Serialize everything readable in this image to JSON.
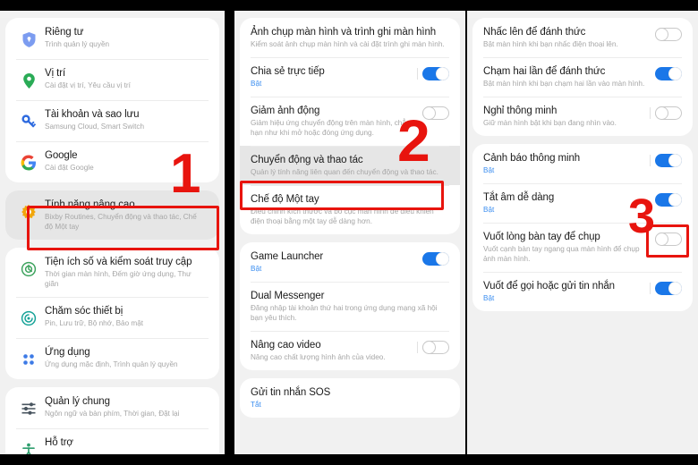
{
  "annotations": {
    "accent_red": "#e8140e",
    "markers": [
      {
        "label": "1"
      },
      {
        "label": "2"
      },
      {
        "label": "3"
      }
    ]
  },
  "colors": {
    "toggle_on": "#1a77e8",
    "state_text": "#3b8ef0",
    "title_text": "#1b1b1b",
    "sub_text": "#a6a6a6",
    "panel_bg": "#f1f1f1",
    "card_bg": "#ffffff",
    "highlight_bg": "#e6e6e6"
  },
  "panels": [
    {
      "name": "settings-main",
      "groups": [
        {
          "rows": [
            {
              "icon": "shield-icon",
              "title": "Riêng tư",
              "sub": "Trình quản lý quyền"
            },
            {
              "icon": "location-pin-icon",
              "title": "Vị trí",
              "sub": "Cài đặt vị trí, Yêu cầu vị trí"
            },
            {
              "icon": "key-icon",
              "title": "Tài khoản và sao lưu",
              "sub": "Samsung Cloud, Smart Switch"
            },
            {
              "icon": "google-g-icon",
              "title": "Google",
              "sub": "Cài đặt Google"
            }
          ]
        },
        {
          "rows": [
            {
              "icon": "gear-icon",
              "title": "Tính năng nâng cao",
              "sub": "Bixby Routines, Chuyển động và thao tác, Chế độ Một tay",
              "highlight": true
            }
          ]
        },
        {
          "rows": [
            {
              "icon": "digital-wellbeing-icon",
              "title": "Tiện ích số và kiểm soát truy cập",
              "sub": "Thời gian màn hình, Đếm giờ ứng dụng, Thư giãn"
            },
            {
              "icon": "device-care-icon",
              "title": "Chăm sóc thiết bị",
              "sub": "Pin, Lưu trữ, Bộ nhớ, Bảo mật"
            },
            {
              "icon": "apps-grid-icon",
              "title": "Ứng dụng",
              "sub": "Ứng dụng mặc định, Trình quản lý quyền"
            }
          ]
        },
        {
          "rows": [
            {
              "icon": "sliders-icon",
              "title": "Quản lý chung",
              "sub": "Ngôn ngữ và bàn phím, Thời gian, Đặt lại"
            },
            {
              "icon": "accessibility-icon",
              "title": "Hỗ trợ",
              "sub": ""
            }
          ]
        }
      ]
    },
    {
      "name": "advanced-features",
      "groups": [
        {
          "rows": [
            {
              "title": "Ảnh chụp màn hình và trình ghi màn hình",
              "sub": "Kiểm soát ảnh chụp màn hình và cài đặt trình ghi màn hình."
            },
            {
              "title": "Chia sẻ trực tiếp",
              "sub": "Bật",
              "sub_state": true,
              "toggle": "on"
            },
            {
              "title": "Giảm ảnh động",
              "sub": "Giảm hiệu ứng chuyển động trên màn hình, chẳng hạn như khi mở hoặc đóng ứng dụng.",
              "toggle": "off"
            },
            {
              "title": "Chuyển động và thao tác",
              "sub": "Quản lý tính năng liên quan đến chuyển động và thao tác.",
              "highlight": true
            },
            {
              "title": "Chế độ Một tay",
              "sub": "Điều chỉnh kích thước và bố cục màn hình để điều khiển điện thoại bằng một tay dễ dàng hơn."
            }
          ]
        },
        {
          "rows": [
            {
              "title": "Game Launcher",
              "sub": "Bật",
              "sub_state": true,
              "toggle": "on"
            },
            {
              "title": "Dual Messenger",
              "sub": "Đăng nhập tài khoản thứ hai trong ứng dụng mạng xã hội bạn yêu thích."
            },
            {
              "title": "Nâng cao video",
              "sub": "Nâng cao chất lượng hình ảnh của video.",
              "toggle": "off"
            }
          ]
        },
        {
          "rows": [
            {
              "title": "Gửi tin nhắn SOS",
              "sub": "Tắt",
              "sub_state": true
            }
          ]
        }
      ]
    },
    {
      "name": "motions-and-gestures",
      "groups": [
        {
          "rows": [
            {
              "title": "Nhấc lên để đánh thức",
              "sub": "Bật màn hình khi bạn nhấc điện thoại lên.",
              "toggle": "off"
            },
            {
              "title": "Chạm hai lần để đánh thức",
              "sub": "Bật màn hình khi bạn chạm hai lần vào màn hình.",
              "toggle": "on"
            },
            {
              "title": "Nghỉ thông minh",
              "sub": "Giữ màn hình bật khi bạn đang nhìn vào.",
              "toggle": "off"
            }
          ]
        },
        {
          "rows": [
            {
              "title": "Cảnh báo thông minh",
              "sub": "Bật",
              "sub_state": true,
              "toggle": "on"
            },
            {
              "title": "Tắt âm dễ dàng",
              "sub": "Bật",
              "sub_state": true,
              "toggle": "on"
            },
            {
              "title": "Vuốt lòng bàn tay để chụp",
              "sub": "Vuốt cạnh bàn tay ngang qua màn hình để chụp ảnh màn hình.",
              "toggle": "off"
            },
            {
              "title": "Vuốt để gọi hoặc gửi tin nhắn",
              "sub": "Bật",
              "sub_state": true,
              "toggle": "on"
            }
          ]
        }
      ]
    }
  ]
}
